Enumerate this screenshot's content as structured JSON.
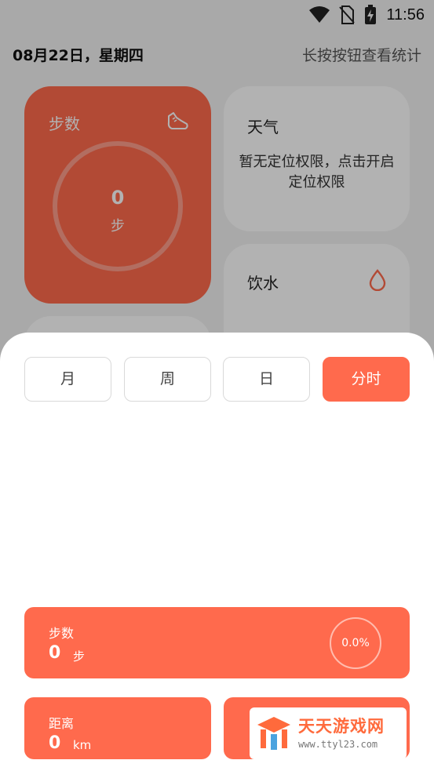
{
  "status_bar": {
    "time": "11:56"
  },
  "header": {
    "date": "08月22日，星期四",
    "hint": "长按按钮查看统计"
  },
  "steps_card": {
    "title": "步数",
    "value": "0",
    "unit": "步",
    "icon": "shoe-icon"
  },
  "weather_card": {
    "title": "天气",
    "message": "暂无定位权限，点击开启定位权限"
  },
  "water_card": {
    "title": "饮水",
    "icon": "water-drop-icon"
  },
  "sheet": {
    "tabs": [
      {
        "label": "月",
        "active": false
      },
      {
        "label": "周",
        "active": false
      },
      {
        "label": "日",
        "active": false
      },
      {
        "label": "分时",
        "active": true
      }
    ],
    "steps_stat": {
      "label": "步数",
      "value": "0",
      "unit": "步",
      "percent": "0.0%"
    },
    "distance_stat": {
      "label": "距离",
      "value": "0",
      "unit": "km"
    }
  },
  "watermark": {
    "title": "天天游戏网",
    "url": "www.ttyl23.com"
  },
  "colors": {
    "accent": "#ff6a4d",
    "background": "#f3f3f3"
  }
}
